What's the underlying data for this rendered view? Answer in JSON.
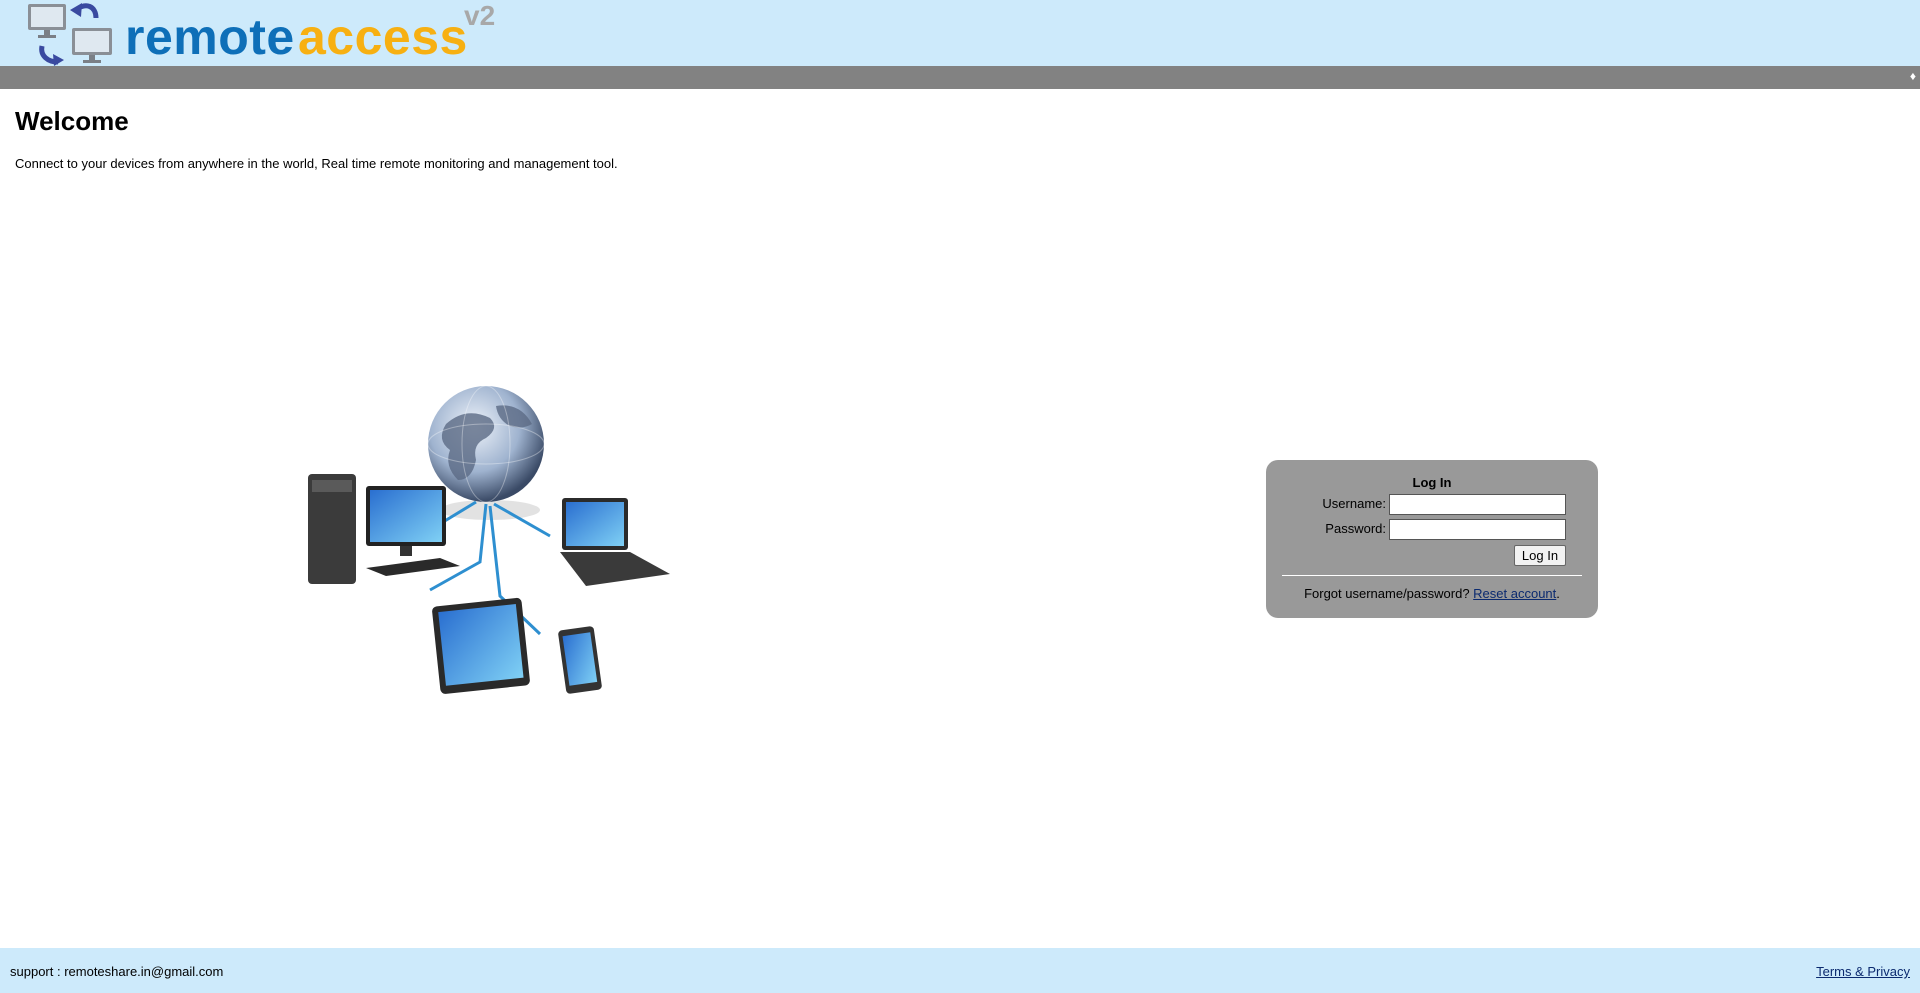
{
  "header": {
    "logo_word_1": "remote",
    "logo_word_2": "access",
    "logo_version": "v2",
    "logo_icon": "two-monitors-sync-icon",
    "colors": {
      "background": "#cdeafb",
      "word_1": "#0e6fb8",
      "word_2": "#f7b012",
      "version": "#a8a8a8"
    }
  },
  "navbar": {
    "toggle_icon": "diamond-icon",
    "toggle_glyph": "♦",
    "color": "#828282"
  },
  "main": {
    "title": "Welcome",
    "tagline": "Connect to your devices from anywhere in the world, Real time remote monitoring and management tool.",
    "hero_image": "globe-network-devices-illustration"
  },
  "login": {
    "title": "Log In",
    "username_label": "Username:",
    "username_value": "",
    "password_label": "Password:",
    "password_value": "",
    "submit_label": "Log In",
    "forgot_text": "Forgot username/password? ",
    "reset_link": "Reset account",
    "period": ".",
    "box_color": "#999999"
  },
  "footer": {
    "support_text": "support : remoteshare.in@gmail.com",
    "terms_link": "Terms & Privacy"
  }
}
